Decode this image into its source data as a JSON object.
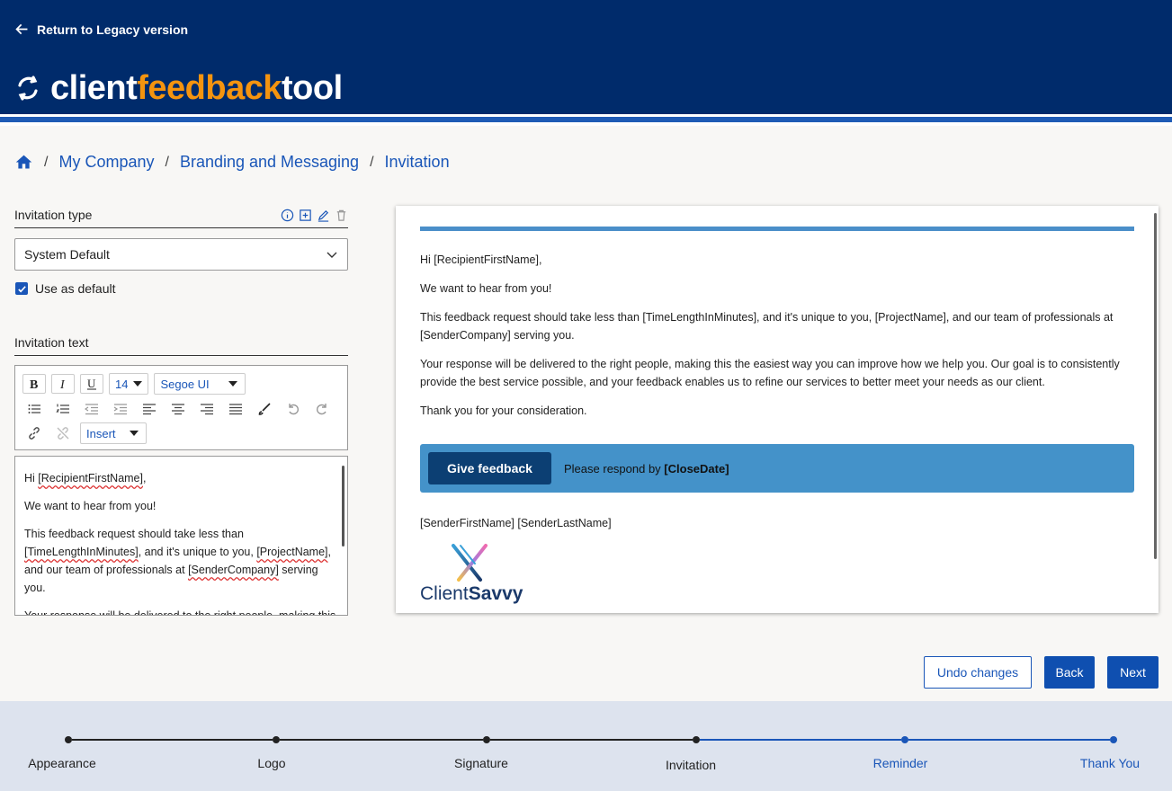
{
  "header": {
    "legacy_link": "Return to Legacy version",
    "logo": {
      "part1": "client",
      "part2": "feedback",
      "part3": "tool"
    }
  },
  "breadcrumb": {
    "items": [
      "My Company",
      "Branding and Messaging",
      "Invitation"
    ],
    "separator": "/"
  },
  "invitation_type": {
    "label": "Invitation type",
    "selected": "System Default",
    "use_as_default_label": "Use as default",
    "use_as_default_checked": true
  },
  "invitation_text": {
    "label": "Invitation text",
    "toolbar": {
      "font_size": "14",
      "font_family": "Segoe UI",
      "insert_label": "Insert"
    },
    "editor": {
      "p1_pre": "Hi ",
      "p1_token": "[RecipientFirstName]",
      "p1_post": ",",
      "p2": "We want to hear from you!",
      "p3_a": "This feedback request should take less than ",
      "p3_token1": "[TimeLengthInMinutes]",
      "p3_b": ", and it's unique to you, ",
      "p3_token2": "[ProjectName]",
      "p3_c": ", and our team of professionals at ",
      "p3_token3": "[SenderCompany]",
      "p3_d": " serving you.",
      "p4": "Your response will be delivered to the right people, making this the easiest way you can improve how we help you. Our goal is to"
    }
  },
  "preview": {
    "greeting": "Hi [RecipientFirstName],",
    "p1": "We want to hear from you!",
    "p2": "This feedback request should take less than [TimeLengthInMinutes], and it's unique to you, [ProjectName], and our team of professionals at [SenderCompany] serving you.",
    "p3": "Your response will be delivered to the right people, making this the easiest way you can improve how we help you. Our goal is to consistently provide the best service possible, and your feedback enables us to refine our services to better meet your needs as our client.",
    "p4": "Thank you for your consideration.",
    "cta_button": "Give feedback",
    "cta_text": "Please respond by ",
    "cta_date": "[CloseDate]",
    "sender": "[SenderFirstName] [SenderLastName]",
    "brand_part1": "Client",
    "brand_part2": "Savvy"
  },
  "actions": {
    "undo": "Undo changes",
    "back": "Back",
    "next": "Next"
  },
  "stepper": {
    "steps": [
      "Appearance",
      "Logo",
      "Signature",
      "Invitation",
      "Reminder",
      "Thank You"
    ],
    "current_index": 3,
    "done_color": "#222222",
    "todo_color": "#1a56b8"
  },
  "colors": {
    "header_bg": "#002b6b",
    "accent_orange": "#f5940f",
    "primary_blue": "#0f4fb0",
    "cta_bg": "#4492c9"
  }
}
